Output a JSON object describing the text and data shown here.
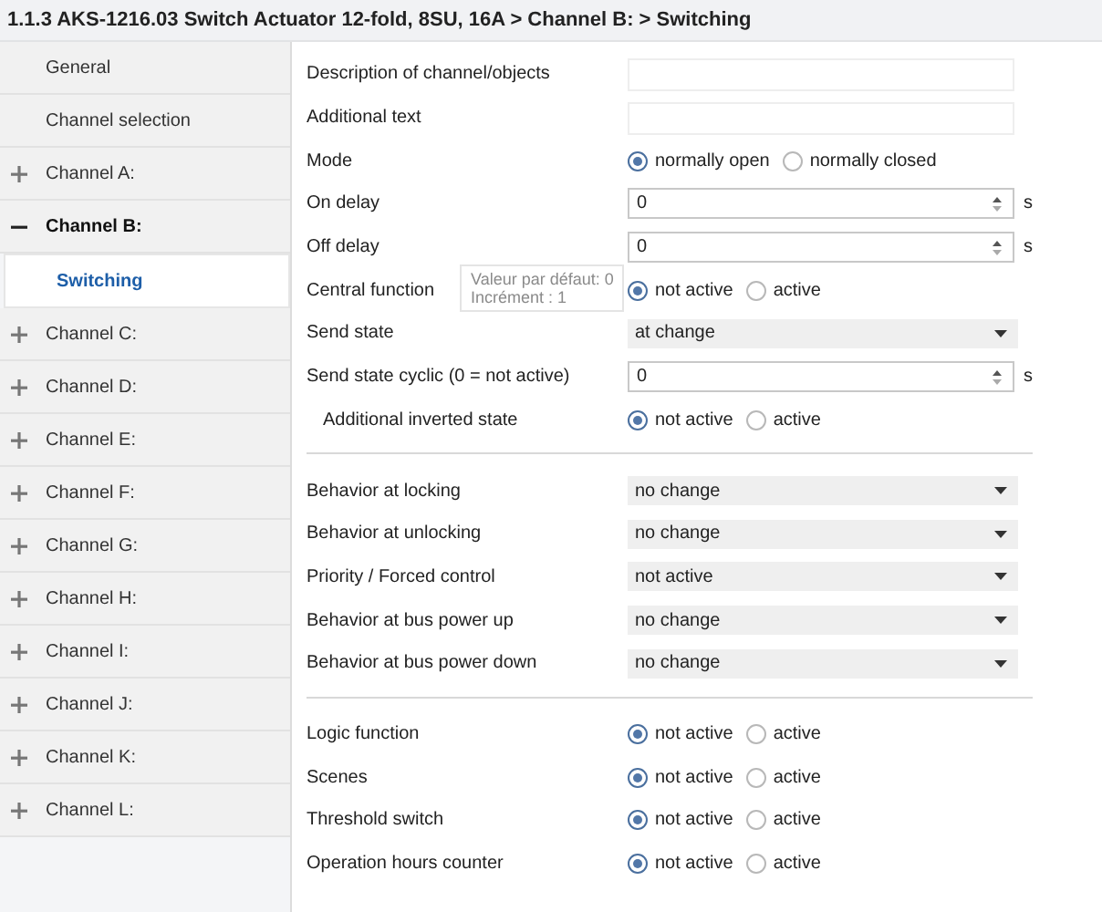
{
  "title": "1.1.3 AKS-1216.03 Switch Actuator 12-fold, 8SU, 16A > Channel B:  > Switching",
  "sidebar": {
    "items": [
      {
        "kind": "page",
        "label": "General",
        "selected": false
      },
      {
        "kind": "page",
        "label": "Channel selection",
        "selected": false
      },
      {
        "kind": "group",
        "label": "Channel A:",
        "expanded": false,
        "selected": false
      },
      {
        "kind": "group",
        "label": "Channel B:",
        "expanded": true,
        "selected": false,
        "children": [
          {
            "label": "Switching",
            "selected": true
          }
        ]
      },
      {
        "kind": "group",
        "label": "Channel C:",
        "expanded": false,
        "selected": false
      },
      {
        "kind": "group",
        "label": "Channel D:",
        "expanded": false,
        "selected": false
      },
      {
        "kind": "group",
        "label": "Channel E:",
        "expanded": false,
        "selected": false
      },
      {
        "kind": "group",
        "label": "Channel F:",
        "expanded": false,
        "selected": false
      },
      {
        "kind": "group",
        "label": "Channel G:",
        "expanded": false,
        "selected": false
      },
      {
        "kind": "group",
        "label": "Channel H:",
        "expanded": false,
        "selected": false
      },
      {
        "kind": "group",
        "label": "Channel I:",
        "expanded": false,
        "selected": false
      },
      {
        "kind": "group",
        "label": "Channel J:",
        "expanded": false,
        "selected": false
      },
      {
        "kind": "group",
        "label": "Channel K:",
        "expanded": false,
        "selected": false
      },
      {
        "kind": "group",
        "label": "Channel L:",
        "expanded": false,
        "selected": false
      }
    ]
  },
  "sections": [
    {
      "rows": [
        {
          "kind": "text",
          "label": "Description of channel/objects",
          "indented": false
        },
        {
          "kind": "text",
          "label": "Additional text",
          "indented": false
        },
        {
          "kind": "radio",
          "label": "Mode",
          "indented": false,
          "options": [
            {
              "label": "normally open",
              "selected": true
            },
            {
              "label": "normally closed",
              "selected": false
            }
          ]
        },
        {
          "kind": "spin",
          "label": "On delay",
          "indented": false,
          "value": "0",
          "unit": "s"
        },
        {
          "kind": "spin",
          "label": "Off delay",
          "indented": false,
          "value": "0",
          "unit": "s"
        },
        {
          "kind": "radio",
          "label": "Central function",
          "indented": false,
          "options": [
            {
              "label": "not active",
              "selected": true
            },
            {
              "label": "active",
              "selected": false
            }
          ]
        },
        {
          "kind": "select",
          "label": "Send state",
          "indented": false,
          "value": "at change"
        },
        {
          "kind": "spin",
          "label": "Send state cyclic (0 = not active)",
          "indented": false,
          "value": "0",
          "unit": "s"
        },
        {
          "kind": "radio",
          "label": "Additional inverted state",
          "indented": true,
          "options": [
            {
              "label": "not active",
              "selected": true
            },
            {
              "label": "active",
              "selected": false
            }
          ]
        }
      ]
    },
    {
      "rows": [
        {
          "kind": "select",
          "label": "Behavior at locking",
          "indented": false,
          "value": "no change"
        },
        {
          "kind": "select",
          "label": "Behavior at unlocking",
          "indented": false,
          "value": "no change"
        },
        {
          "kind": "select",
          "label": "Priority / Forced control",
          "indented": false,
          "value": "not active"
        },
        {
          "kind": "select",
          "label": "Behavior at bus power up",
          "indented": false,
          "value": "no change"
        },
        {
          "kind": "select",
          "label": "Behavior at bus power down",
          "indented": false,
          "value": "no change"
        }
      ]
    },
    {
      "rows": [
        {
          "kind": "radio",
          "label": "Logic function",
          "indented": false,
          "options": [
            {
              "label": "not active",
              "selected": true
            },
            {
              "label": "active",
              "selected": false
            }
          ]
        },
        {
          "kind": "radio",
          "label": "Scenes",
          "indented": false,
          "options": [
            {
              "label": "not active",
              "selected": true
            },
            {
              "label": "active",
              "selected": false
            }
          ]
        },
        {
          "kind": "radio",
          "label": "Threshold switch",
          "indented": false,
          "options": [
            {
              "label": "not active",
              "selected": true
            },
            {
              "label": "active",
              "selected": false
            }
          ]
        },
        {
          "kind": "radio",
          "label": "Operation hours counter",
          "indented": false,
          "options": [
            {
              "label": "not active",
              "selected": true
            },
            {
              "label": "active",
              "selected": false
            }
          ]
        }
      ]
    }
  ],
  "tooltip": {
    "lines": [
      "Valeur par défaut: 0",
      "Incrément : 1"
    ]
  }
}
